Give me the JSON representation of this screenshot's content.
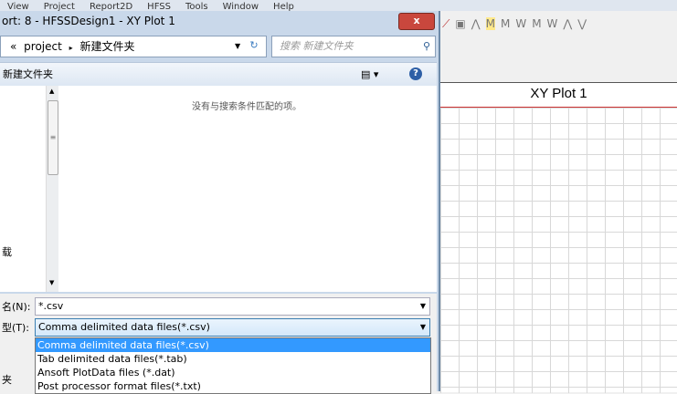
{
  "menu": [
    "View",
    "Project",
    "Report2D",
    "HFSS",
    "Tools",
    "Window",
    "Help"
  ],
  "toolbar_icons": [
    "curve-icon",
    "copy-icon",
    "peak-icon",
    "double-peak-icon",
    "m-icon",
    "w-icon",
    "mw-icon",
    "w2-icon",
    "up-icon",
    "down-icon"
  ],
  "plot": {
    "title": "XY Plot 1"
  },
  "dialog": {
    "title": "ort: 8 - HFSSDesign1 - XY Plot 1",
    "close": "x",
    "address": {
      "prefix": "«",
      "parent": "project",
      "sep": "▸",
      "current": "新建文件夹"
    },
    "search_placeholder": "搜索 新建文件夹",
    "cmdbar_folder": "新建文件夹",
    "empty_message": "没有与搜索条件匹配的项。",
    "nav_item": "载",
    "filename_label": "名(N):",
    "filename_value": "*.csv",
    "filetype_label": "型(T):",
    "filetype_value": "Comma delimited data files(*.csv)",
    "hide_folders": "夹",
    "filetype_options": [
      "Comma delimited data files(*.csv)",
      "Tab delimited data files(*.tab)",
      "Ansoft PlotData files (*.dat)",
      "Post processor format files(*.txt)"
    ]
  }
}
